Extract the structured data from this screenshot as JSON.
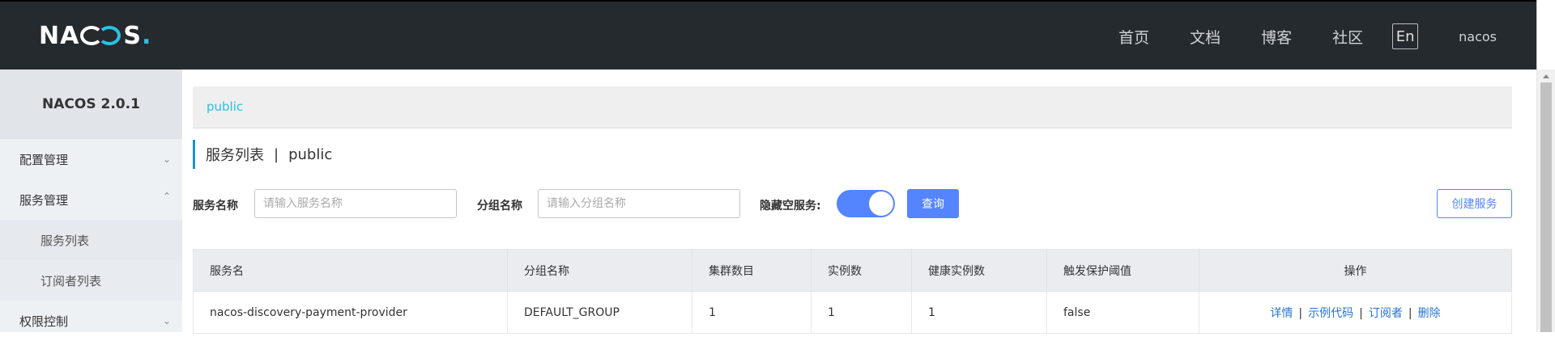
{
  "header": {
    "logo_text_start": "NA",
    "logo_text_end": "S",
    "logo_dot": ".",
    "nav": [
      "首页",
      "文档",
      "博客",
      "社区"
    ],
    "lang": "En",
    "user": "nacos"
  },
  "sidebar": {
    "version": "NACOS 2.0.1",
    "items": [
      {
        "label": "配置管理"
      },
      {
        "label": "服务管理"
      },
      {
        "label": "服务列表"
      },
      {
        "label": "订阅者列表"
      },
      {
        "label": "权限控制"
      }
    ]
  },
  "namespace": {
    "label": "public"
  },
  "page": {
    "title": "服务列表",
    "sep": "|",
    "namespace": "public"
  },
  "filters": {
    "service_label": "服务名称",
    "service_placeholder": "请输入服务名称",
    "group_label": "分组名称",
    "group_placeholder": "请输入分组名称",
    "hide_empty_label": "隐藏空服务:",
    "hide_empty_on": true,
    "query_label": "查询",
    "create_label": "创建服务"
  },
  "table": {
    "columns": [
      "服务名",
      "分组名称",
      "集群数目",
      "实例数",
      "健康实例数",
      "触发保护阈值",
      "操作"
    ],
    "rows": [
      {
        "service": "nacos-discovery-payment-provider",
        "group": "DEFAULT_GROUP",
        "clusters": "1",
        "instances": "1",
        "healthy": "1",
        "threshold": "false",
        "ops": [
          "详情",
          "示例代码",
          "订阅者",
          "删除"
        ]
      }
    ]
  },
  "colors": {
    "primary": "#5584ff",
    "header_bg": "#252a2f",
    "accent": "#2bc0e4"
  }
}
